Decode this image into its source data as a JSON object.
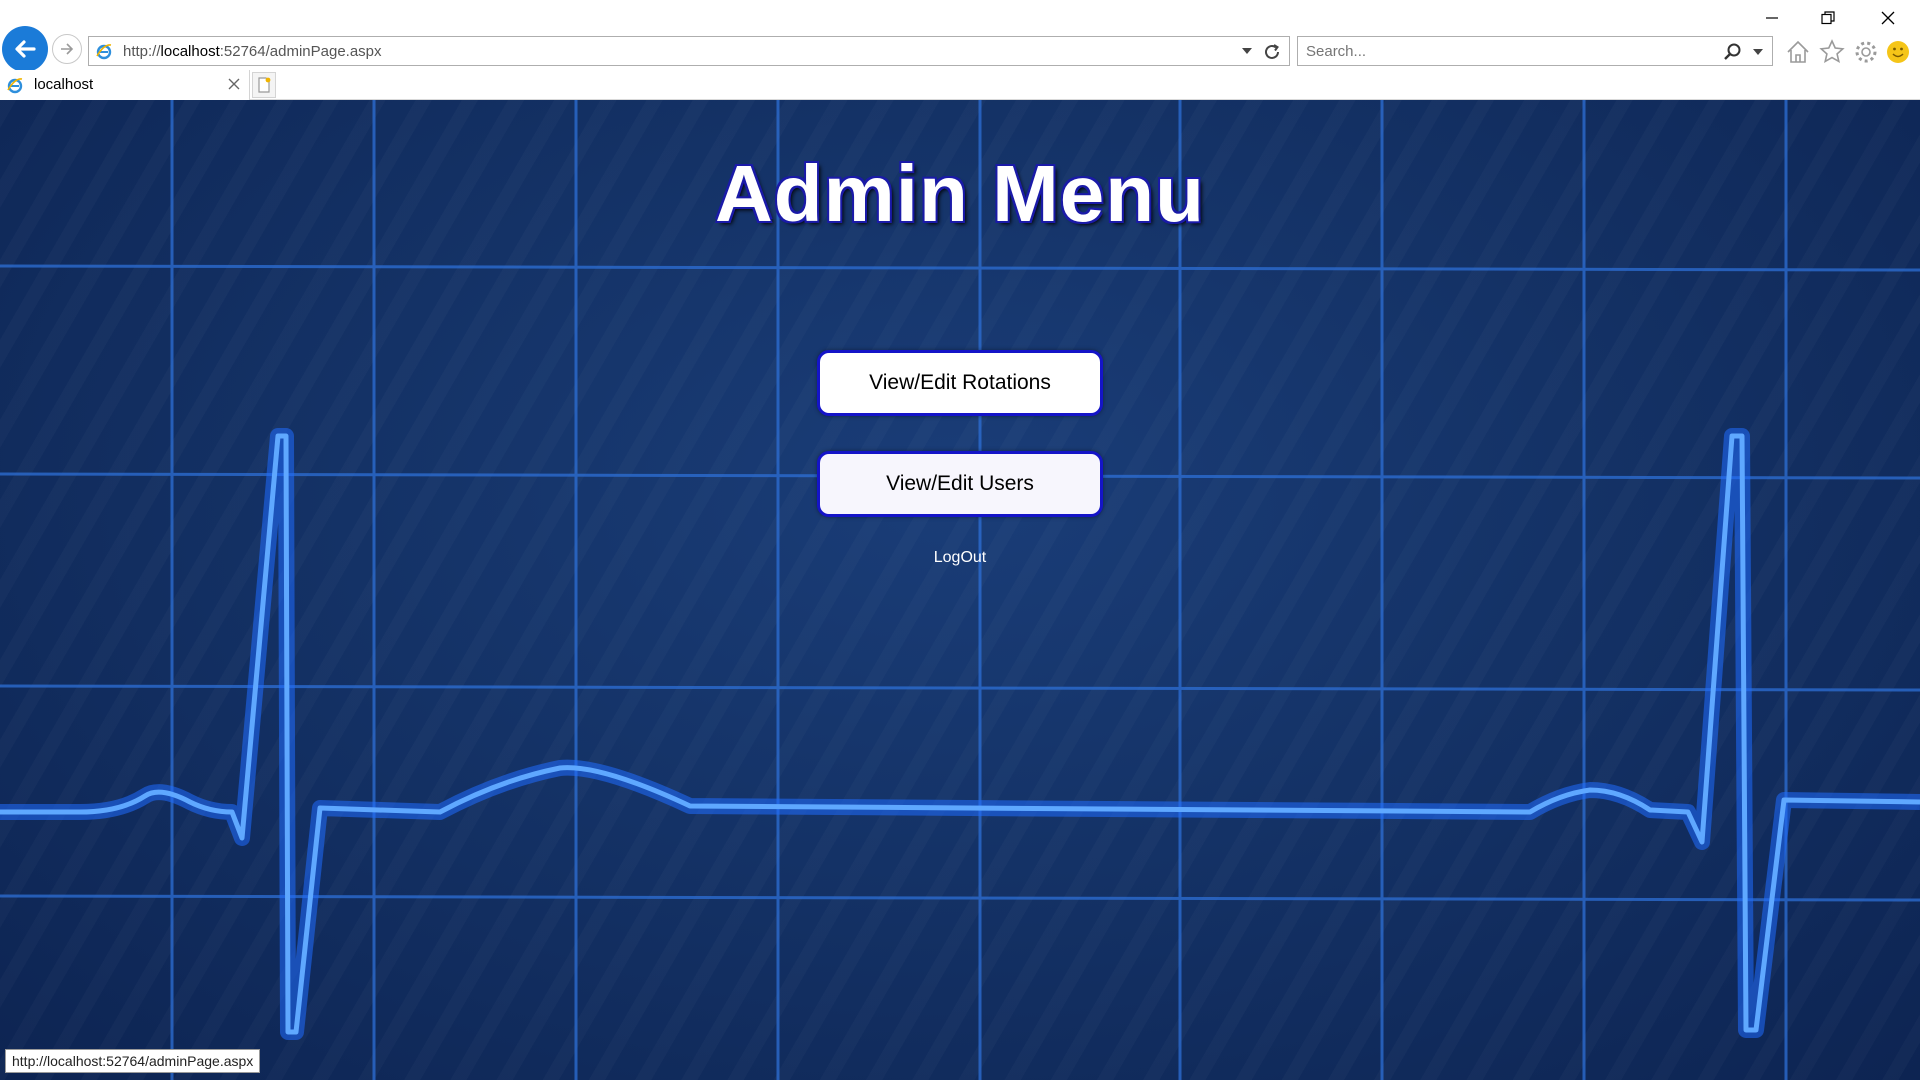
{
  "browser": {
    "address_prefix": "http://",
    "address_host": "localhost",
    "address_rest": ":52764/adminPage.aspx",
    "search_placeholder": "Search...",
    "tab_title": "localhost",
    "accent_color": "#1b7bd8"
  },
  "page": {
    "title": "Admin Menu",
    "buttons": [
      {
        "label": "View/Edit Rotations"
      },
      {
        "label": "View/Edit Users"
      }
    ],
    "logout_label": "LogOut",
    "background_color": "#143266",
    "heartbeat_color": "#2a7dff"
  },
  "status_bar": {
    "hover_url": "http://localhost:52764/adminPage.aspx"
  }
}
